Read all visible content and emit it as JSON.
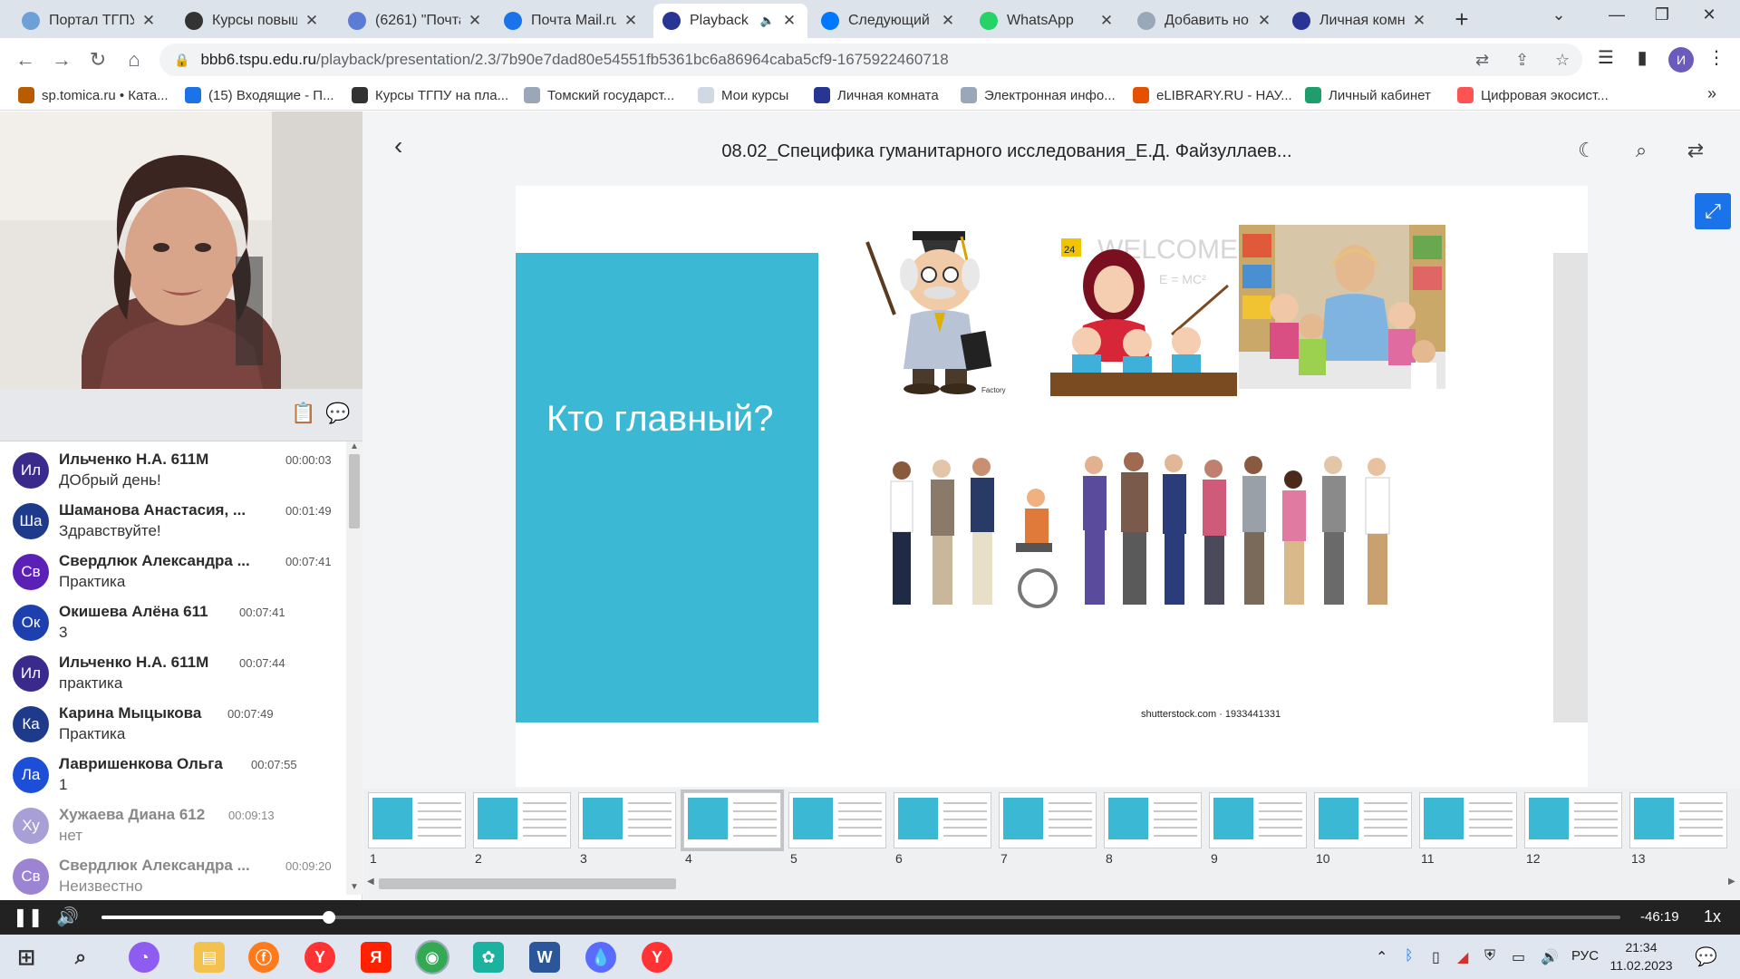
{
  "browser": {
    "tabs": [
      {
        "title": "Портал ТГПУ",
        "favicon_color": "#6ea0d8",
        "active": false
      },
      {
        "title": "Курсы повыш...",
        "favicon_color": "#333333",
        "active": false
      },
      {
        "title": "(6261) \"Почта...",
        "favicon_color": "#5b7bd5",
        "active": false
      },
      {
        "title": "Почта Mail.ru",
        "favicon_color": "#1a73e8",
        "active": false
      },
      {
        "title": "Playback",
        "favicon_color": "#283593",
        "active": true,
        "audio": "🔈"
      },
      {
        "title": "Следующий у...",
        "favicon_color": "#0077ff",
        "active": false
      },
      {
        "title": "WhatsApp",
        "favicon_color": "#25d366",
        "active": false
      },
      {
        "title": "Добавить нов...",
        "favicon_color": "#9aa7b8",
        "active": false
      },
      {
        "title": "Личная комн...",
        "favicon_color": "#283593",
        "active": false
      }
    ],
    "new_tab": "+",
    "url_host": "bbb6.tspu.edu.ru",
    "url_path": "/playback/presentation/2.3/7b90e7dad80e54551fb5361bc6a86964caba5cf9-1675922460718",
    "profile_initial": "И",
    "bookmarks": [
      {
        "label": "sp.tomica.ru • Ката...",
        "color": "#b85c00"
      },
      {
        "label": "(15) Входящие - П...",
        "color": "#1a73e8"
      },
      {
        "label": "Курсы ТГПУ на пла...",
        "color": "#333333"
      },
      {
        "label": "Томский государст...",
        "color": "#9aa7b8"
      },
      {
        "label": "Мои курсы",
        "color": "#cfd8e3"
      },
      {
        "label": "Личная комната",
        "color": "#283593"
      },
      {
        "label": "Электронная инфо...",
        "color": "#9aa7b8"
      },
      {
        "label": "eLIBRARY.RU - НАУ...",
        "color": "#e65100"
      },
      {
        "label": "Личный кабинет",
        "color": "#1e9e6a"
      },
      {
        "label": "Цифровая экосист...",
        "color": "#ff5252"
      }
    ],
    "bookmarks_more": "»"
  },
  "presentation": {
    "title": "08.02_Специфика гуманитарного исследования_Е.Д. Файзуллаев...",
    "slide_heading": "Кто главный?",
    "image_credit": "shutterstock.com · 1933441331",
    "welcome_text": "WELCOME",
    "formula_text": "E = MC²",
    "calendar_day": "24",
    "small_logo_text": "Factory",
    "teal_color": "#3bb8d4",
    "current_slide": 4,
    "thumbnails": [
      "1",
      "2",
      "3",
      "4",
      "5",
      "6",
      "7",
      "8",
      "9",
      "10",
      "11",
      "12",
      "13"
    ]
  },
  "chat": {
    "messages": [
      {
        "initials": "Ил",
        "name": "Ильченко Н.А. 611М",
        "time": "00:00:03",
        "text": "ДОбрый день!",
        "color": "#3a2a8c"
      },
      {
        "initials": "Ша",
        "name": "Шаманова Анастасия, ...",
        "time": "00:01:49",
        "text": "Здравствуйте!",
        "color": "#1e3a8a"
      },
      {
        "initials": "Св",
        "name": "Свердлюк Александра ...",
        "time": "00:07:41",
        "text": "Практика",
        "color": "#5b21b6"
      },
      {
        "initials": "Ок",
        "name": "Окишева Алёна 611",
        "time": "00:07:41",
        "text": "3",
        "color": "#1e40af"
      },
      {
        "initials": "Ил",
        "name": "Ильченко Н.А. 611М",
        "time": "00:07:44",
        "text": "практика",
        "color": "#3a2a8c"
      },
      {
        "initials": "Ка",
        "name": "Карина Мыцыкова",
        "time": "00:07:49",
        "text": "Практика",
        "color": "#1e3a8a"
      },
      {
        "initials": "Ла",
        "name": "Лавришенкова Ольга",
        "time": "00:07:55",
        "text": "1",
        "color": "#1d4ed8"
      },
      {
        "initials": "Ху",
        "name": "Хужаева Диана 612",
        "time": "00:09:13",
        "text": "нет",
        "color": "#8b7fc9"
      },
      {
        "initials": "Св",
        "name": "Свердлюк Александра ...",
        "time": "00:09:20",
        "text": "Неизвестно",
        "color": "#7c5cc4"
      }
    ]
  },
  "player": {
    "remaining": "-46:19",
    "speed": "1x",
    "progress": 0.15
  },
  "taskbar": {
    "language": "РУС",
    "time": "21:34",
    "date": "11.02.2023"
  }
}
